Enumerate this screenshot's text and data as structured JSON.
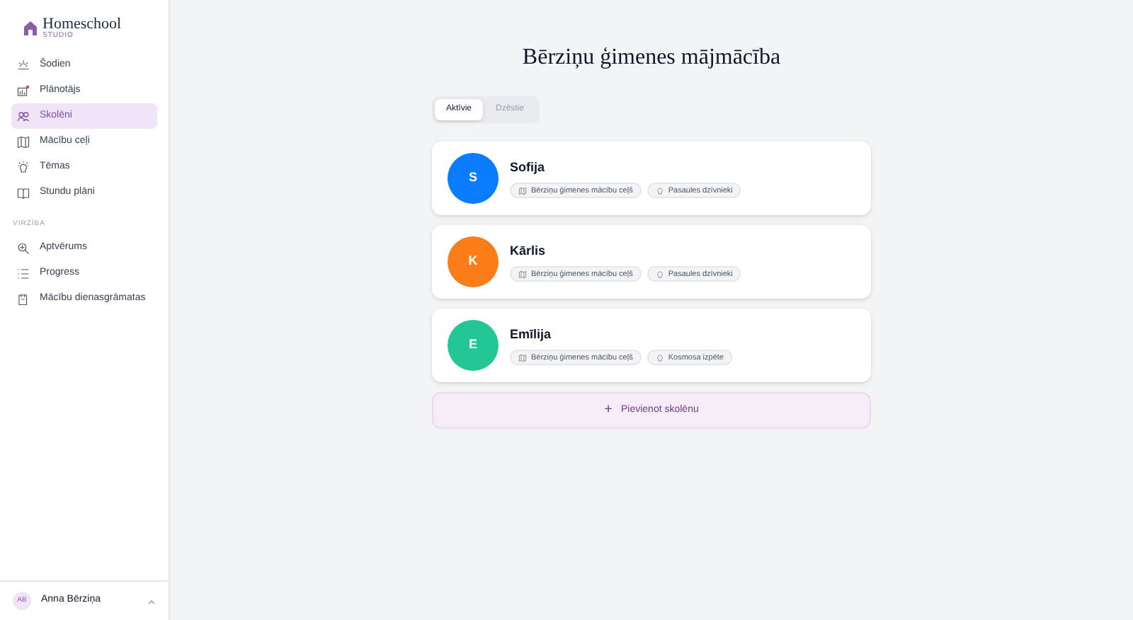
{
  "logo": {
    "name": "Homeschool",
    "subtitle": "STUDIO"
  },
  "nav": [
    {
      "label": "Šodien",
      "selected": false
    },
    {
      "label": "Plānotājs",
      "selected": false
    },
    {
      "label": "Skolēni",
      "selected": true
    },
    {
      "label": "Mācību ceļi",
      "selected": false
    },
    {
      "label": "Tēmas",
      "selected": false
    },
    {
      "label": "Stundu plāni",
      "selected": false
    }
  ],
  "section": {
    "title": "VIRZĪBA",
    "items": [
      {
        "label": "Aptvērums",
        "selected": false
      },
      {
        "label": "Progress",
        "selected": false
      },
      {
        "label": "Mācību dienasgrāmatas",
        "selected": false
      }
    ]
  },
  "user": {
    "initials": "AB",
    "name": "Anna Bērziņa"
  },
  "title": "Bērziņu ģimenes mājmācība",
  "tabs": [
    {
      "label": "Aktīvie",
      "selected": true
    },
    {
      "label": "Dzēstie",
      "selected": false
    }
  ],
  "students": [
    {
      "initial": "S",
      "name": "Sofija",
      "color": "#0a7cff",
      "path": "Bērziņu ģimenes mācību ceļš",
      "theme": "Pasaules dzīvnieki"
    },
    {
      "initial": "K",
      "name": "Kārlis",
      "color": "#fb7d1a",
      "path": "Bērziņu ģimenes mācību ceļš",
      "theme": "Pasaules dzīvnieki"
    },
    {
      "initial": "E",
      "name": "Emīlija",
      "color": "#22c795",
      "path": "Bērziņu ģimenes mācību ceļš",
      "theme": "Kosmosa izpēte"
    }
  ],
  "add_button": {
    "icon": "+",
    "label": "Pievienot skolēnu"
  }
}
